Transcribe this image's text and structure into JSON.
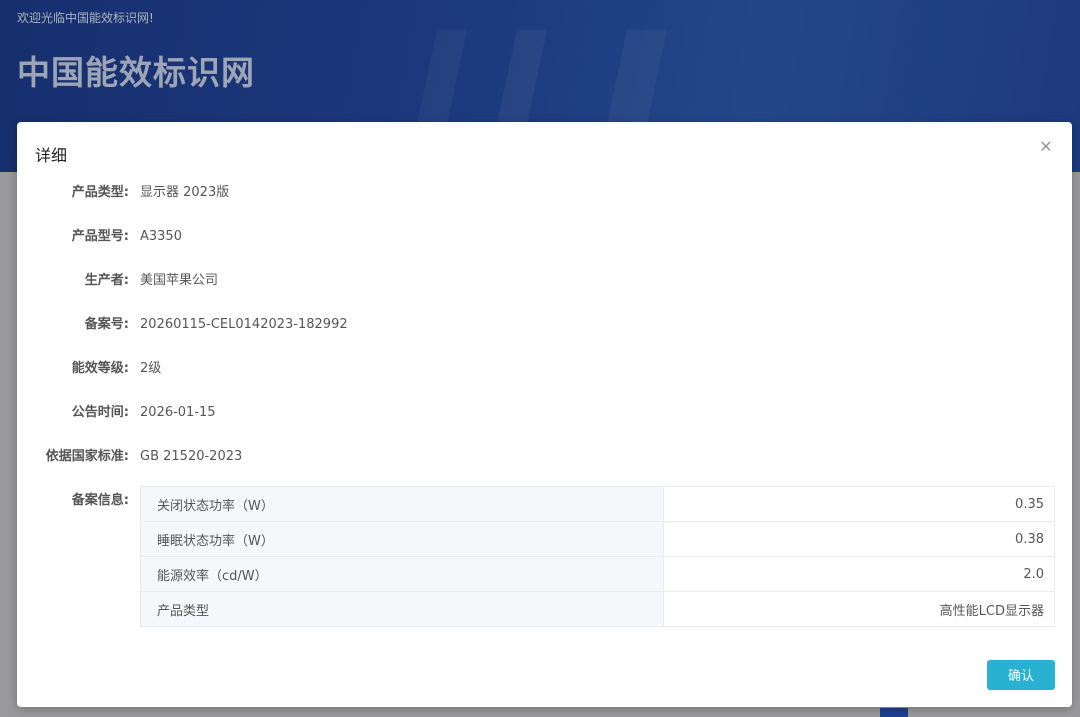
{
  "header": {
    "welcome_text": "欢迎光临中国能效标识网!",
    "site_title": "中国能效标识网"
  },
  "modal": {
    "title": "详细",
    "close_icon": "close-icon",
    "fields": [
      {
        "label": "产品类型:",
        "value": "显示器 2023版"
      },
      {
        "label": "产品型号:",
        "value": "A3350"
      },
      {
        "label": "生产者:",
        "value": "美国苹果公司"
      },
      {
        "label": "备案号:",
        "value": "20260115-CEL0142023-182992"
      },
      {
        "label": "能效等级:",
        "value": "2级"
      },
      {
        "label": "公告时间:",
        "value": "2026-01-15"
      },
      {
        "label": "依据国家标准:",
        "value": "GB 21520-2023"
      }
    ],
    "record_label": "备案信息:",
    "record_rows": [
      {
        "key": "关闭状态功率（W）",
        "value": "0.35"
      },
      {
        "key": "睡眠状态功率（W）",
        "value": "0.38"
      },
      {
        "key": "能源效率（cd/W）",
        "value": "2.0"
      },
      {
        "key": "产品类型",
        "value": "高性能LCD显示器"
      }
    ],
    "confirm_label": "确认"
  },
  "colors": {
    "header_blue": "#23489b",
    "confirm_button": "#29b1d2",
    "overlay_gray": "#9a9a9c"
  }
}
